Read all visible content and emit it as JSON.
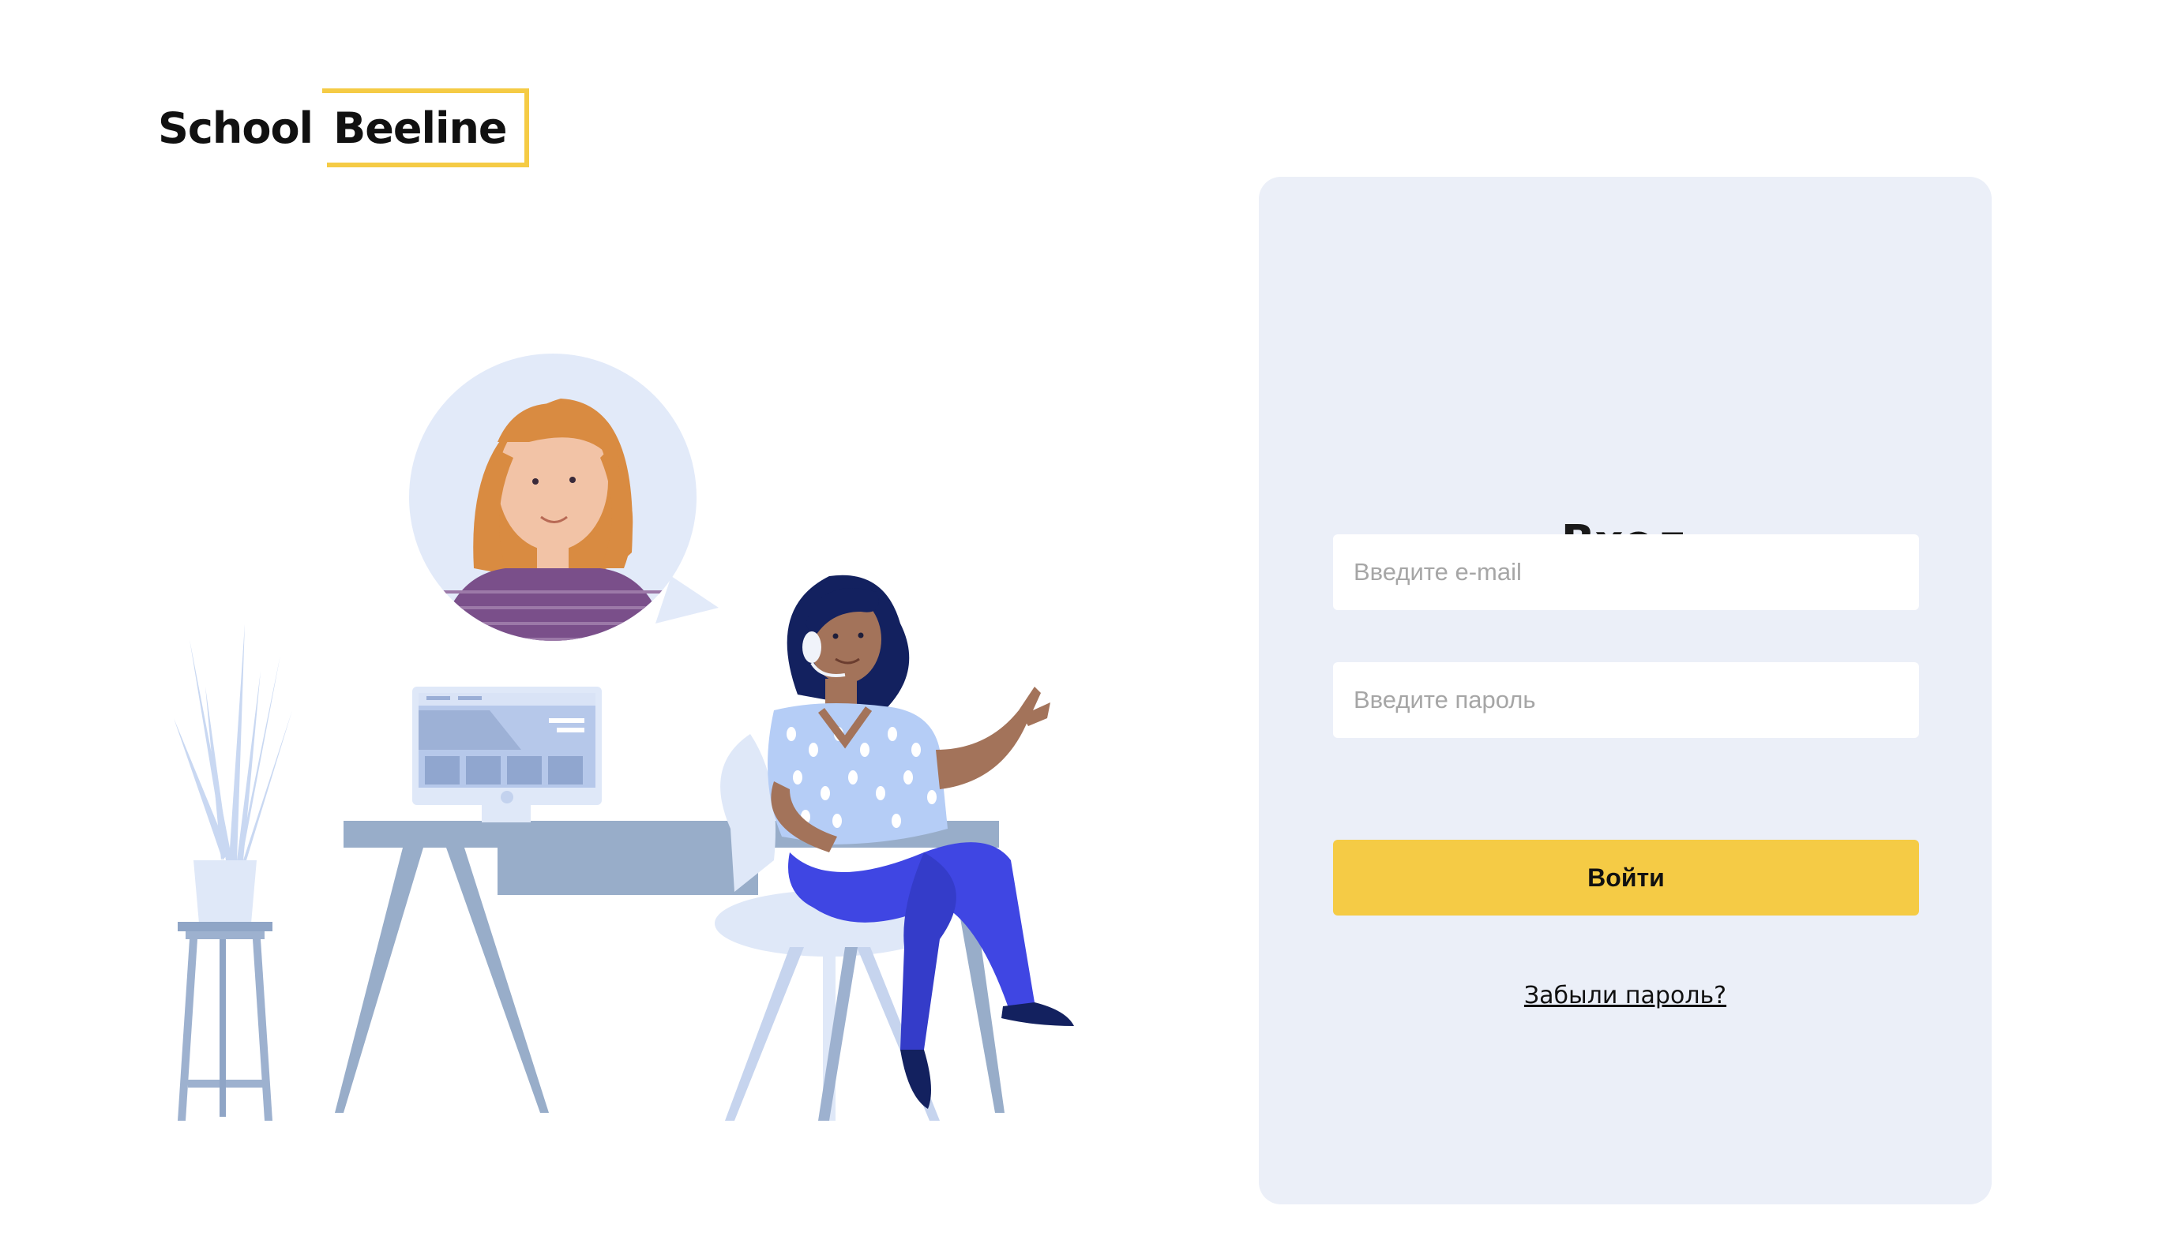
{
  "brand": {
    "word1": "School",
    "word2": "Beeline",
    "accent_color": "#f5cb45"
  },
  "login": {
    "title": "Вход",
    "email_placeholder": "Введите e-mail",
    "password_placeholder": "Введите пароль",
    "submit_label": "Войти",
    "forgot_label": "Забыли пароль?",
    "button_color": "#f5cb45",
    "panel_color": "#ebeff8"
  }
}
